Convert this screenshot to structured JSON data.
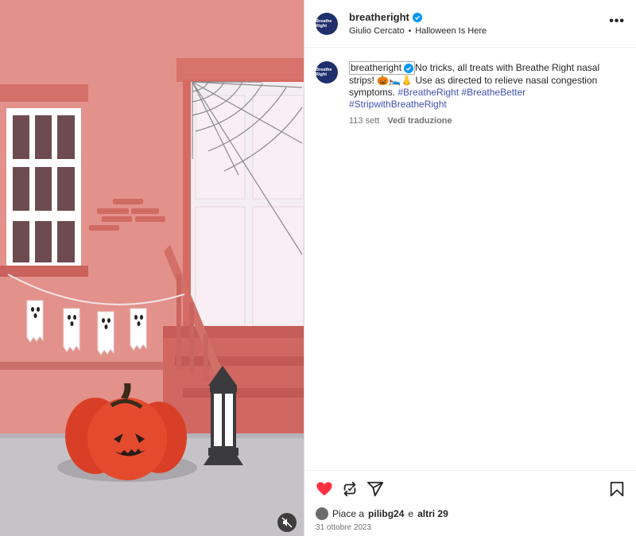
{
  "post": {
    "account": "breatheright",
    "avatar_text": "Breathe Right",
    "music_artist": "Giulio Cercato",
    "music_separator": "•",
    "music_title": "Halloween Is Here",
    "more_label": "•••"
  },
  "caption": {
    "username": "breatheright",
    "text_before_emoji": "No tricks, all treats with Breathe Right nasal strips! ",
    "emojis": "🎃🛌👃",
    "text_after_emoji": " Use as directed to relieve nasal congestion symptoms. ",
    "hashtags": [
      "#BreatheRight",
      "#BreatheBetter",
      "#StripwithBreatheRight"
    ],
    "age": "113 sett",
    "translate_label": "Vedi traduzione"
  },
  "footer": {
    "likes_prefix": "Piace a",
    "liker": "pilibg24",
    "likes_joiner": "e",
    "others": "altri 29",
    "date": "31 ottobre 2023"
  },
  "colors": {
    "like_red": "#ff3040",
    "brand_navy": "#1f2f6b",
    "verified_blue": "#0095f6",
    "hashtag_blue": "#3f51b5"
  },
  "icons": {
    "like": "heart-icon",
    "repost": "repost-icon",
    "share": "send-icon",
    "save": "bookmark-icon",
    "mute": "speaker-muted-icon",
    "verified": "verified-badge-icon"
  }
}
